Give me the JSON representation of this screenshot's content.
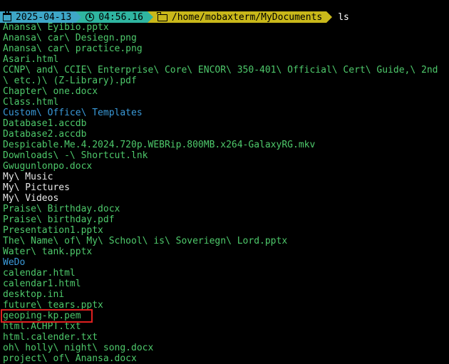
{
  "prompt": {
    "date": "2025-04-13",
    "time": "04:56.16",
    "path": "/home/mobaxterm/MyDocuments",
    "command": "ls"
  },
  "colors": {
    "file": "#4ec96b",
    "directory": "#3a9ad9",
    "plain": "#e8e8e8",
    "highlight": "#e02020"
  },
  "listing": [
    {
      "text": "Anansa\\ Eyibio.pptx",
      "kind": "file"
    },
    {
      "text": "Anansa\\ car\\ Desiegn.png",
      "kind": "file"
    },
    {
      "text": "Anansa\\ car\\ practice.png",
      "kind": "file"
    },
    {
      "text": "Asari.html",
      "kind": "file"
    },
    {
      "text": "CCNP\\ and\\ CCIE\\ Enterprise\\ Core\\ ENCOR\\ 350-401\\ Official\\ Cert\\ Guide,\\ 2nd",
      "kind": "file"
    },
    {
      "text": "\\ etc.)\\ (Z-Library).pdf",
      "kind": "file"
    },
    {
      "text": "Chapter\\ one.docx",
      "kind": "file"
    },
    {
      "text": "Class.html",
      "kind": "file"
    },
    {
      "text": "Custom\\ Office\\ Templates",
      "kind": "dir"
    },
    {
      "text": "Database1.accdb",
      "kind": "file"
    },
    {
      "text": "Database2.accdb",
      "kind": "file"
    },
    {
      "text": "Despicable.Me.4.2024.720p.WEBRip.800MB.x264-GalaxyRG.mkv",
      "kind": "file"
    },
    {
      "text": "Downloads\\ -\\ Shortcut.lnk",
      "kind": "file"
    },
    {
      "text": "Gwugunlonpo.docx",
      "kind": "file"
    },
    {
      "text": "My\\ Music",
      "kind": "plain"
    },
    {
      "text": "My\\ Pictures",
      "kind": "plain"
    },
    {
      "text": "My\\ Videos",
      "kind": "plain"
    },
    {
      "text": "Praise\\ Birthday.docx",
      "kind": "file"
    },
    {
      "text": "Praise\\ birthday.pdf",
      "kind": "file"
    },
    {
      "text": "Presentation1.pptx",
      "kind": "file"
    },
    {
      "text": "The\\ Name\\ of\\ My\\ School\\ is\\ Soveriegn\\ Lord.pptx",
      "kind": "file"
    },
    {
      "text": "Water\\ tank.pptx",
      "kind": "file"
    },
    {
      "text": "WeDo",
      "kind": "dir"
    },
    {
      "text": "calendar.html",
      "kind": "file"
    },
    {
      "text": "calendar1.html",
      "kind": "file"
    },
    {
      "text": "desktop.ini",
      "kind": "file"
    },
    {
      "text": "future\\ tears.pptx",
      "kind": "file"
    },
    {
      "text": "geoping-kp.pem",
      "kind": "file"
    },
    {
      "text": "html.ACHPT.txt",
      "kind": "file"
    },
    {
      "text": "html.calender.txt",
      "kind": "file"
    },
    {
      "text": "oh\\ holly\\ night\\ song.docx",
      "kind": "file"
    },
    {
      "text": "project\\ of\\ Anansa.docx",
      "kind": "file"
    }
  ]
}
